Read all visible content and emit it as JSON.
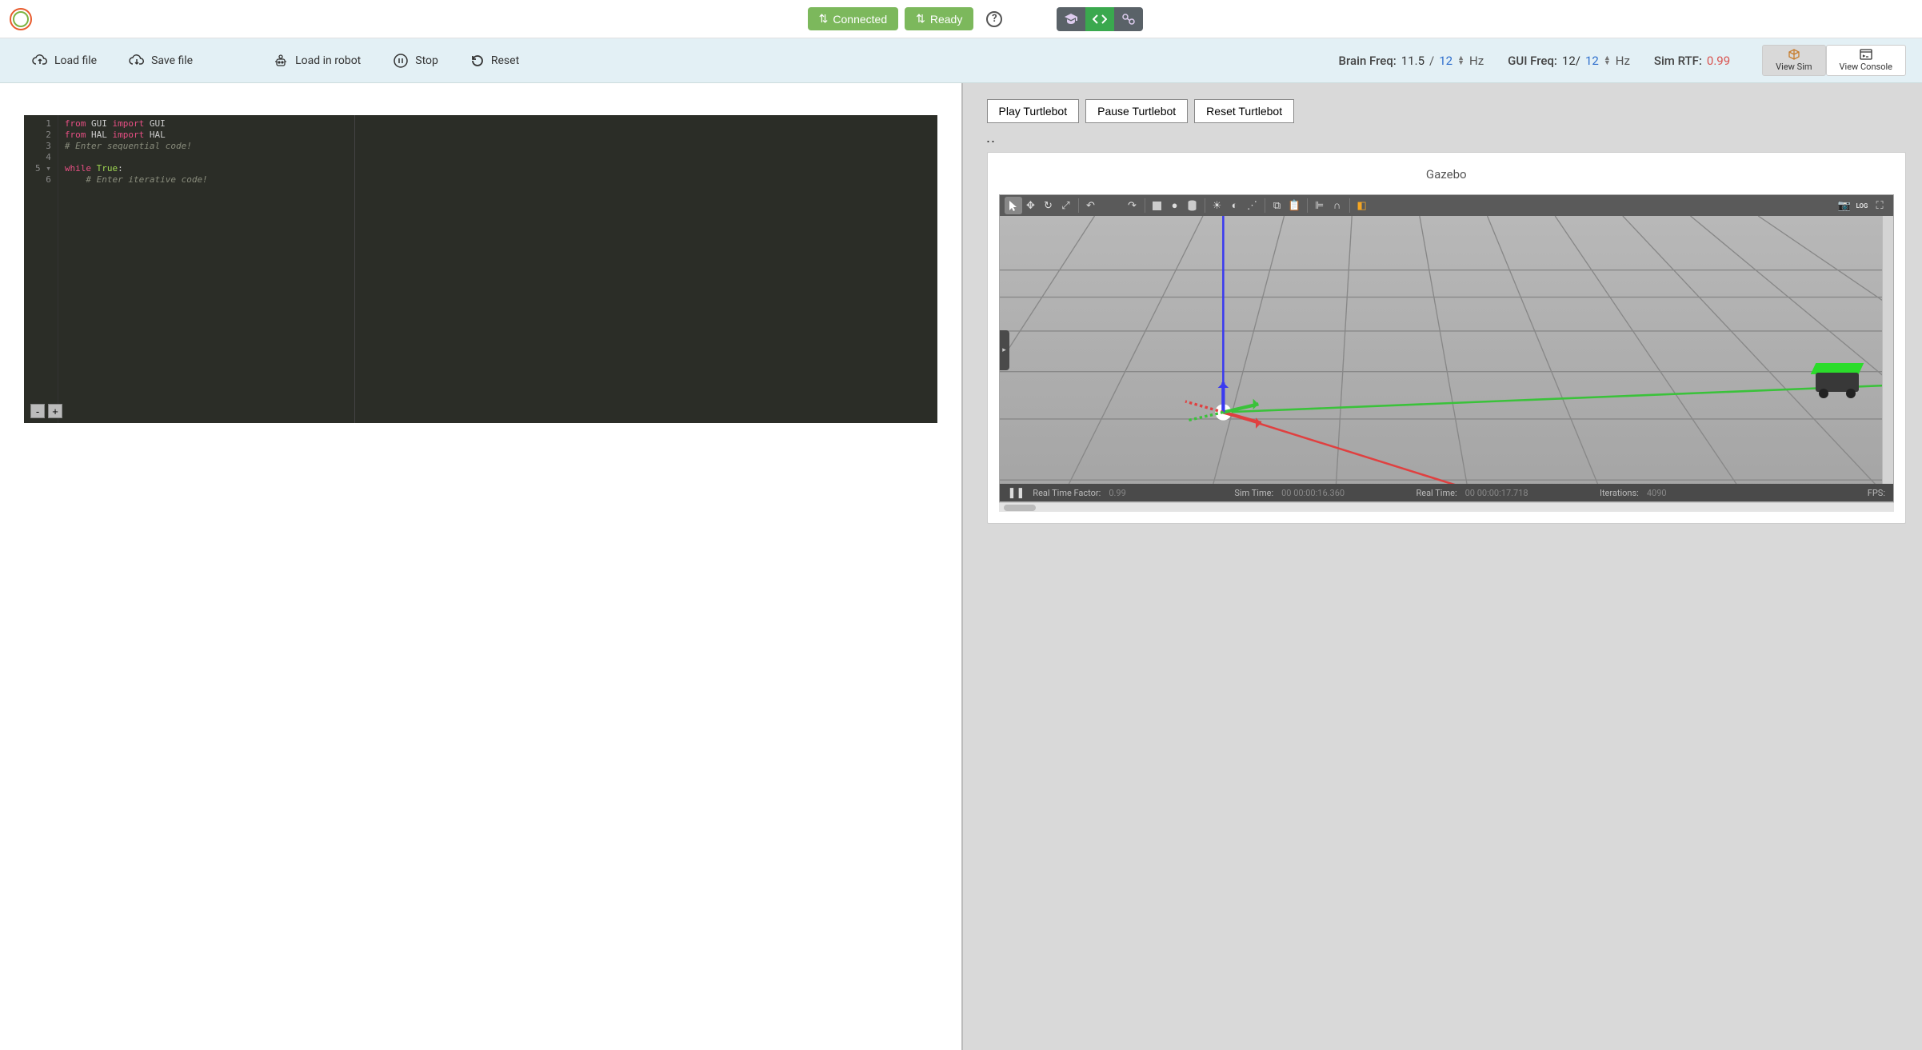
{
  "header": {
    "connected_label": "Connected",
    "ready_label": "Ready"
  },
  "actions": {
    "load_file": "Load file",
    "save_file": "Save file",
    "load_robot": "Load in robot",
    "stop": "Stop",
    "reset": "Reset"
  },
  "freq": {
    "brain_label": "Brain Freq:",
    "brain_actual": "11.5",
    "brain_sep": "/",
    "brain_target": "12",
    "brain_unit": "Hz",
    "gui_label": "GUI Freq:",
    "gui_actual": "12/",
    "gui_target": "12",
    "gui_unit": "Hz",
    "rtf_label": "Sim RTF:",
    "rtf_value": "0.99"
  },
  "view_tabs": {
    "sim": "View Sim",
    "console": "View Console"
  },
  "editor": {
    "lines": [
      "1",
      "2",
      "3",
      "4",
      "5",
      "6"
    ],
    "l1_kw1": "from",
    "l1_id1": " GUI ",
    "l1_kw2": "import",
    "l1_id2": " GUI",
    "l2_kw1": "from",
    "l2_id1": " HAL ",
    "l2_kw2": "import",
    "l2_id2": " HAL",
    "l3": "# Enter sequential code!",
    "l5_kw1": "while ",
    "l5_kw2": "True",
    "l5_colon": ":",
    "l6": "    # Enter iterative code!",
    "minus": "-",
    "plus": "+"
  },
  "turtlebot": {
    "play": "Play Turtlebot",
    "pause": "Pause Turtlebot",
    "reset": "Reset Turtlebot",
    "dots": ".."
  },
  "gazebo": {
    "title": "Gazebo",
    "status": {
      "rtf_label": "Real Time Factor:",
      "rtf_value": "0.99",
      "simtime_label": "Sim Time:",
      "simtime_value": "00 00:00:16.360",
      "realtime_label": "Real Time:",
      "realtime_value": "00 00:00:17.718",
      "iter_label": "Iterations:",
      "iter_value": "4090",
      "fps_label": "FPS:"
    }
  }
}
